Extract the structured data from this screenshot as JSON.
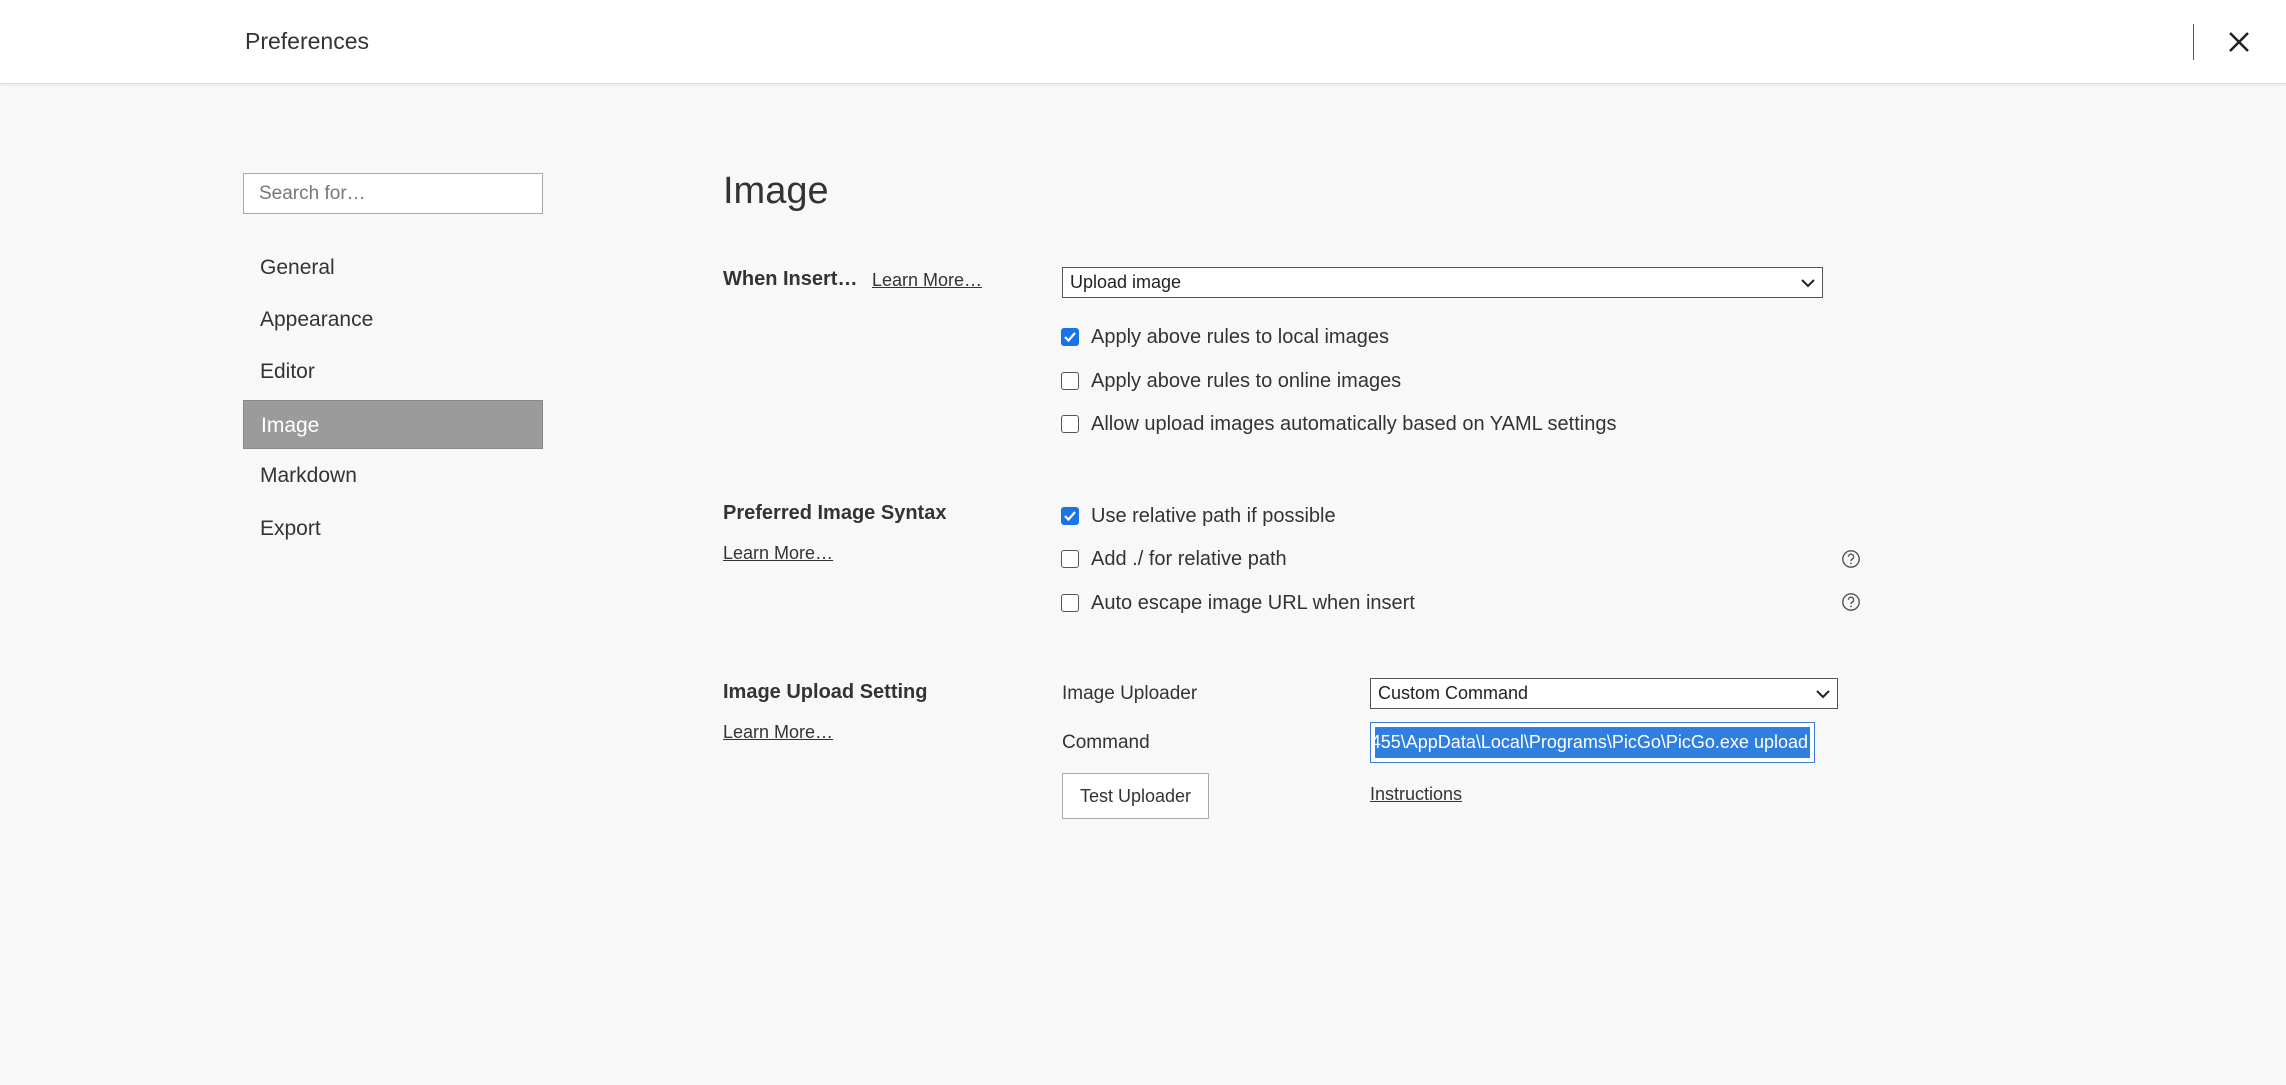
{
  "window": {
    "title": "Preferences"
  },
  "sidebar": {
    "search_placeholder": "Search for…",
    "items": [
      {
        "label": "General"
      },
      {
        "label": "Appearance"
      },
      {
        "label": "Editor"
      },
      {
        "label": "Image",
        "active": true
      },
      {
        "label": "Markdown"
      },
      {
        "label": "Export"
      }
    ]
  },
  "main": {
    "title": "Image",
    "when_insert": {
      "label": "When Insert…",
      "learn_more": "Learn More…",
      "select_value": "Upload image",
      "options": [
        {
          "label": "Apply above rules to local images",
          "checked": true
        },
        {
          "label": "Apply above rules to online images",
          "checked": false
        },
        {
          "label": "Allow upload images automatically based on YAML settings",
          "checked": false
        }
      ]
    },
    "syntax": {
      "label": "Preferred Image Syntax",
      "learn_more": "Learn More…",
      "options": [
        {
          "label": "Use relative path if possible",
          "checked": true
        },
        {
          "label": "Add ./ for relative path",
          "checked": false
        },
        {
          "label": "Auto escape image URL when insert",
          "checked": false
        }
      ]
    },
    "upload": {
      "label": "Image Upload Setting",
      "learn_more": "Learn More…",
      "uploader_label": "Image Uploader",
      "uploader_value": "Custom Command",
      "command_label": "Command",
      "command_value": "455\\AppData\\Local\\Programs\\PicGo\\PicGo.exe upload",
      "test_button": "Test Uploader",
      "instructions_link": "Instructions"
    }
  },
  "colors": {
    "accent": "#1a73e8",
    "selection": "#2f7fe0",
    "active_nav": "#9b9b9b"
  },
  "icons": {
    "close": "close-icon",
    "help": "help-circle-icon",
    "chevron": "chevron-down-icon",
    "check": "checkmark-icon"
  }
}
